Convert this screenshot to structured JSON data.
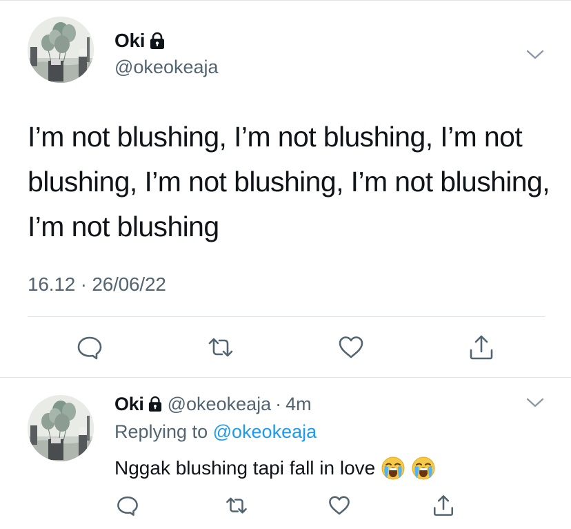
{
  "main_tweet": {
    "author_name": "Oki",
    "author_handle": "@okeokeaja",
    "protected_icon": "lock-icon",
    "text": "I’m not blushing, I’m not blushing, I’m not blushing, I’m not blushing, I’m not blushing, I’m not blushing",
    "timestamp": "16.12 · 26/06/22",
    "actions": [
      "reply-icon",
      "retweet-icon",
      "like-icon",
      "share-icon"
    ]
  },
  "reply_tweet": {
    "author_name": "Oki",
    "author_handle": "@okeokeaja",
    "separator": "·",
    "time_ago": "4m",
    "replying_prefix": "Replying to",
    "replying_to": "@okeokeaja",
    "text": "Nggak blushing tapi fall in love",
    "emojis": [
      "loudly-crying-face",
      "loudly-crying-face"
    ],
    "actions": [
      "reply-icon",
      "retweet-icon",
      "like-icon",
      "share-icon"
    ]
  },
  "colors": {
    "text_primary": "#0f1419",
    "text_secondary": "#536471",
    "link": "#1d9bf0",
    "divider": "#dfe3e6"
  }
}
